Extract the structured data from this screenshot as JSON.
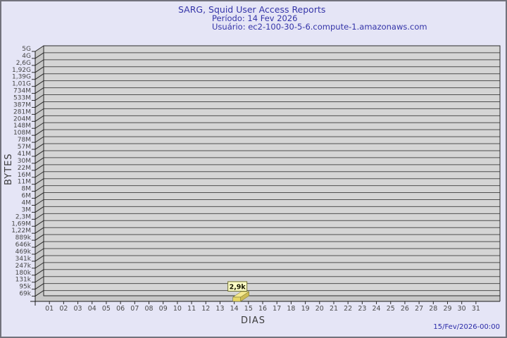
{
  "header": {
    "title": "SARG, Squid User Access Reports",
    "period": "Período: 14 Fev 2026",
    "user": "Usuário: ec2-100-30-5-6.compute-1.amazonaws.com"
  },
  "footer": {
    "timestamp": "15/Fev/2026-00:00"
  },
  "chart_data": {
    "type": "bar",
    "title": "SARG, Squid User Access Reports",
    "subtitle_period": "Período: 14 Fev 2026",
    "subtitle_user": "Usuário: ec2-100-30-5-6.compute-1.amazonaws.com",
    "xlabel": "DIAS",
    "ylabel": "BYTES",
    "x_categories": [
      "01",
      "02",
      "03",
      "04",
      "05",
      "06",
      "07",
      "08",
      "09",
      "10",
      "11",
      "12",
      "13",
      "14",
      "15",
      "16",
      "17",
      "18",
      "19",
      "20",
      "21",
      "22",
      "23",
      "24",
      "25",
      "26",
      "27",
      "28",
      "29",
      "30",
      "31"
    ],
    "y_tick_labels": [
      "5G",
      "4G",
      "2,6G",
      "1,92G",
      "1,39G",
      "1,01G",
      "734M",
      "533M",
      "387M",
      "281M",
      "204M",
      "148M",
      "108M",
      "78M",
      "57M",
      "41M",
      "30M",
      "22M",
      "16M",
      "11M",
      "8M",
      "6M",
      "4M",
      "3M",
      "2,3M",
      "1,69M",
      "1,22M",
      "889k",
      "646k",
      "469k",
      "341k",
      "247k",
      "180k",
      "131k",
      "95k",
      "69k"
    ],
    "y_axis_min_label": "69k",
    "y_axis_max_label": "5G",
    "grid": true,
    "legend": "none",
    "values": [
      0,
      0,
      0,
      0,
      0,
      0,
      0,
      0,
      0,
      0,
      0,
      0,
      0,
      2900,
      0,
      0,
      0,
      0,
      0,
      0,
      0,
      0,
      0,
      0,
      0,
      0,
      0,
      0,
      0,
      0,
      0
    ],
    "bars": [
      {
        "day": "14",
        "value_bytes": 2900,
        "value_label": "2,9k"
      }
    ],
    "annotations": [
      {
        "x": "14",
        "text": "2,9k"
      }
    ],
    "colors": {
      "background": "#e5e5f6",
      "frame_border": "#72727c",
      "title_text": "#3434a8",
      "footer_text": "#2a2aa8",
      "plot_face": "#d5d5d5",
      "plot_wall": "#c7c7c7",
      "grid_line": "#4f4f4f",
      "axis_line": "#1a1a1a",
      "bar_front": "#e8d767",
      "bar_top": "#f4e88f",
      "bar_side": "#cdbb55",
      "bar_outline": "#6b6b2a",
      "bar_label_bg": "#ffffc6",
      "bar_label_border": "#707030"
    }
  }
}
